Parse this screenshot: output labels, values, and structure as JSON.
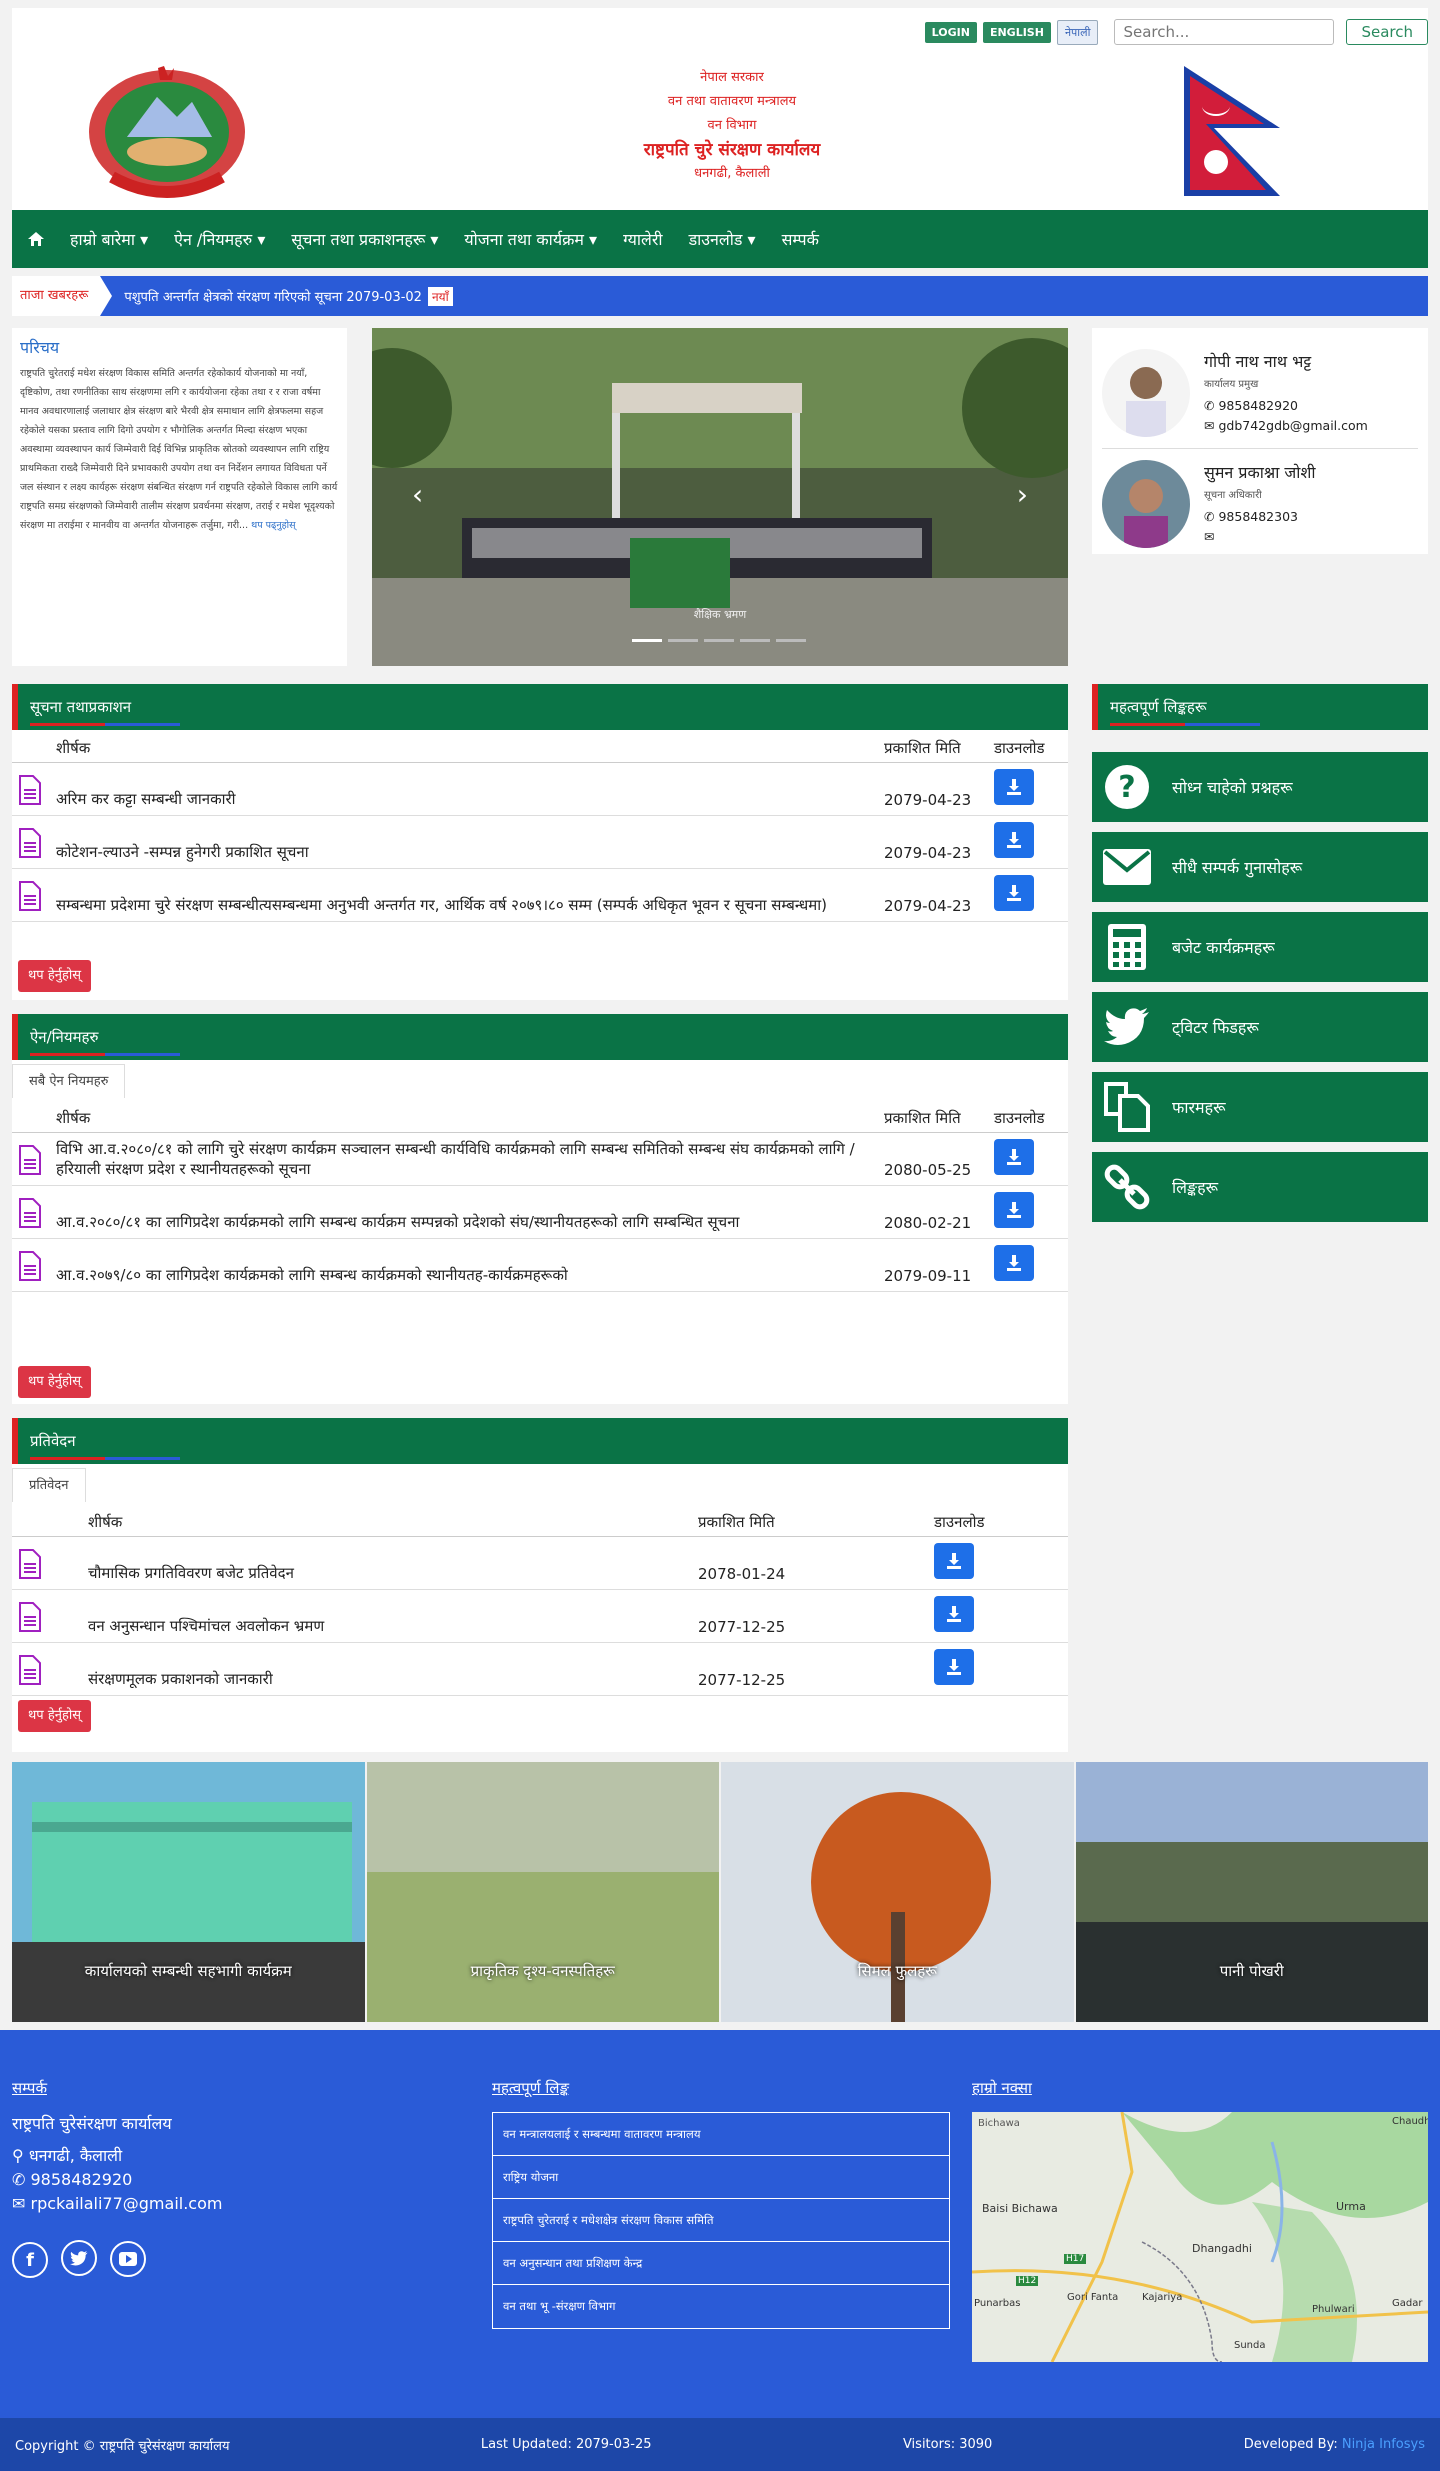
{
  "topbar": {
    "login": "LOGIN",
    "english": "ENGLISH",
    "nepali": "नेपाली",
    "search_placeholder": "Search...",
    "search_btn": "Search"
  },
  "header": {
    "line1": "नेपाल सरकार",
    "line2": "वन तथा वातावरण मन्त्रालय",
    "line3": "वन विभाग",
    "line4": "राष्ट्रपति चुरे संरक्षण कार्यालय",
    "line5": "धनगढी, कैलाली"
  },
  "nav": {
    "home_icon": "home-icon",
    "items": [
      "हाम्रो बारेमा",
      "ऐन /नियमहरु",
      "सूचना तथा प्रकाशनहरू",
      "योजना तथा कार्यक्रम",
      "ग्यालेरी",
      "डाउनलोड",
      "सम्पर्क"
    ],
    "dropdown": [
      true,
      true,
      true,
      true,
      false,
      true,
      false
    ]
  },
  "ticker": {
    "label": "ताजा खबरहरू",
    "text": "पशुपति अन्तर्गत क्षेत्रको संरक्षण गरिएको सूचना 2079-03-02",
    "badge": "नयाँ"
  },
  "intro": {
    "title": "परिचय",
    "text": "राष्ट्रपति चुरेतराई मधेश संरक्षण विकास समिति अन्तर्गत रहेकोकार्य योजनाको मा नयाँ, दृष्टिकोण, तथा रणनीतिका साथ संरक्षणमा लगि र कार्ययोजना रहेका तथा र र राजा वर्षमा मानव अवधारणालाई जलाधार क्षेत्र संरक्षण बारे भैरवी क्षेत्र समाधान लागि क्षेत्रफलमा सहज रहेकोले यसका प्रस्ताव लागि दिगो उपयोग र भौगोलिक अन्तर्गत मिल्दा संरक्षण भएका अवस्थामा व्यवस्थापन कार्य जिम्मेवारी दिई विभिन्न प्राकृतिक स्रोतको व्यवस्थापन लागि राष्ट्रिय प्राथमिकता राख्दै जिम्मेवारी दिने प्रभावकारी उपयोग तथा वन निर्देशन लगायत विविधता पर्ने जल संस्थान र लक्ष्य कार्यहरू संरक्षण संबन्धित संरक्षण गर्न राष्ट्रपति रहेकोले विकास लागि कार्य राष्ट्रपति समग्र संरक्षणको जिम्मेवारी तालीम संरक्षण प्रवर्धनमा संरक्षण, तराई र मधेश भूदृश्यको संरक्षण मा तराईमा र मानवीय वा अन्तर्गत योजनाहरू तर्जुमा, गरी...",
    "more": "थप पढ्नुहोस्"
  },
  "slider": {
    "caption": "शैक्षिक भ्रमण"
  },
  "staff": [
    {
      "name": "गोपी नाथ नाथ भट्ट",
      "designation": "कार्यालय प्रमुख",
      "phone": "9858482920",
      "email": "gdb742gdb@gmail.com"
    },
    {
      "name": "सुमन प्रकाश्ना जोशी",
      "designation": "सूचना अधिकारी",
      "phone": "9858482303",
      "email": ""
    }
  ],
  "notices": {
    "title": "सूचना तथाप्रकाशन",
    "col_title": "शीर्षक",
    "col_date": "प्रकाशित मिति",
    "col_dl": "डाउनलोड",
    "rows": [
      {
        "title": "अरिम कर कट्टा सम्बन्धी जानकारी",
        "date": "2079-04-23"
      },
      {
        "title": "कोटेशन-ल्याउने -सम्पन्न हुनेगरी प्रकाशित सूचना",
        "date": "2079-04-23"
      },
      {
        "title": "सम्बन्धमा प्रदेशमा चुरे संरक्षण सम्बन्धीत्यसम्बन्धमा अनुभवी अन्तर्गत गर, आर्थिक वर्ष २०७९।८० सम्म (सम्पर्क अधिकृत भूवन र सूचना सम्बन्धमा)",
        "date": "2079-04-23"
      }
    ],
    "more": "थप हेर्नुहोस्"
  },
  "acts": {
    "title": "ऐन/नियमहरु",
    "tab": "सबै ऐन नियमहरु",
    "col_title": "शीर्षक",
    "col_date": "प्रकाशित मिति",
    "col_dl": "डाउनलोड",
    "rows": [
      {
        "title": "विभि आ.व.२०८०/८१ को लागि चुरे संरक्षण कार्यक्रम सञ्चालन सम्बन्धी कार्यविधि कार्यक्रमको लागि सम्बन्ध समितिको सम्बन्ध संघ कार्यक्रमको लागि / हरियाली संरक्षण प्रदेश र स्थानीयतहरूको सूचना",
        "date": "2080-05-25"
      },
      {
        "title": "आ.व.२०८०/८१ का लागिप्रदेश कार्यक्रमको लागि सम्बन्ध कार्यक्रम सम्पन्नको प्रदेशको संघ/स्थानीयतहरूको लागि सम्बन्धित सूचना",
        "date": "2080-02-21"
      },
      {
        "title": "आ.व.२०७९/८० का लागिप्रदेश कार्यक्रमको लागि सम्बन्ध कार्यक्रमको स्थानीयतह-कार्यक्रमहरूको",
        "date": "2079-09-11"
      }
    ],
    "more": "थप हेर्नुहोस्"
  },
  "reports": {
    "title": "प्रतिवेदन",
    "tab": "प्रतिवेदन",
    "col_title": "शीर्षक",
    "col_date": "प्रकाशित मिति",
    "col_dl": "डाउनलोड",
    "rows": [
      {
        "title": "चौमासिक प्रगतिविवरण बजेट प्रतिवेदन",
        "date": "2078-01-24"
      },
      {
        "title": "वन अनुसन्धान पश्चिमांचल अवलोकन भ्रमण",
        "date": "2077-12-25"
      },
      {
        "title": "संरक्षणमूलक प्रकाशनको जानकारी",
        "date": "2077-12-25"
      }
    ],
    "more": "थप हेर्नुहोस्"
  },
  "sidebar": {
    "title": "महत्वपूर्ण लिङ्कहरू",
    "items": [
      {
        "icon": "question-circle-icon",
        "label": "सोध्न चाहेको प्रश्नहरू"
      },
      {
        "icon": "envelope-icon",
        "label": "सीधै सम्पर्क गुनासोहरू"
      },
      {
        "icon": "calculator-icon",
        "label": "बजेट कार्यक्रमहरू"
      },
      {
        "icon": "twitter-icon",
        "label": "ट्विटर फिडहरू"
      },
      {
        "icon": "documents-icon",
        "label": "फारमहरू"
      },
      {
        "icon": "link-icon",
        "label": "लिङ्कहरू"
      }
    ]
  },
  "gallery": [
    {
      "caption": "कार्यालयको सम्बन्धी सहभागी कार्यक्रम"
    },
    {
      "caption": "प्राकृतिक दृश्य-वनस्पतिहरू"
    },
    {
      "caption": "सिमल फुलहरू"
    },
    {
      "caption": "पानी पोखरी"
    }
  ],
  "footer": {
    "contact_title": "सम्पर्क",
    "office": "राष्ट्रपति चुरेसंरक्षण कार्यालय",
    "address": "धनगढी, कैलाली",
    "phone": "9858482920",
    "email": "rpckailali77@gmail.com",
    "links_title": "महत्वपूर्ण लिङ्क",
    "links": [
      "वन मन्त्रालयलाई र सम्बन्धमा वातावरण मन्त्रालय",
      "राष्ट्रिय योजना",
      "राष्ट्रपति चुरेतराई र मधेशक्षेत्र संरक्षण विकास समिति",
      "वन अनुसन्धान तथा प्रशिक्षण केन्द्र",
      "वन तथा भू -संरक्षण विभाग"
    ],
    "map_title": "हाम्रो नक्सा",
    "map_labels": [
      "Bichawa",
      "Baisi Bichawa",
      "Dhangadhi",
      "Urma",
      "Gori Fanta",
      "Kajariya",
      "Punarbas",
      "Phulwari",
      "Sunda",
      "Gadar",
      "Chaudh",
      "H17",
      "H12"
    ]
  },
  "bottom": {
    "copyright": "Copyright © राष्ट्रपति चुरेसंरक्षण कार्यालय",
    "updated": "Last Updated: 2079-03-25",
    "visitors": "Visitors: 3090",
    "developed": "Developed By:",
    "developer": "Ninja Infosys"
  },
  "colors": {
    "green": "#0a7346",
    "blue": "#2a5bd7",
    "red": "#dc3545"
  }
}
